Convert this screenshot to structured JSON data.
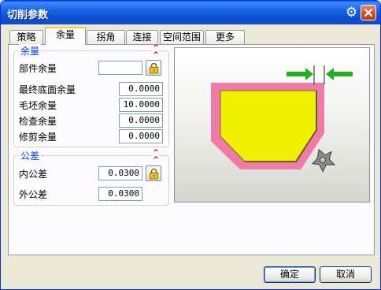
{
  "window": {
    "title": "切削参数"
  },
  "tabs": [
    {
      "label": "策略"
    },
    {
      "label": "余量"
    },
    {
      "label": "拐角"
    },
    {
      "label": "连接"
    },
    {
      "label": "空间范围"
    },
    {
      "label": "更多"
    }
  ],
  "active_tab": "余量",
  "stock_group": {
    "title": "余量",
    "part_stock": {
      "label": "部件余量",
      "value": ""
    },
    "final_floor_stock": {
      "label": "最终底面余量",
      "value": "0.0000"
    },
    "blank_stock": {
      "label": "毛坯余量",
      "value": "10.0000"
    },
    "check_stock": {
      "label": "检查余量",
      "value": "0.0000"
    },
    "trim_stock": {
      "label": "修剪余量",
      "value": "0.0000"
    }
  },
  "tolerance_group": {
    "title": "公差",
    "intol": {
      "label": "内公差",
      "value": "0.0300"
    },
    "outtol": {
      "label": "外公差",
      "value": "0.0300"
    }
  },
  "buttons": {
    "ok": "确定",
    "cancel": "取消"
  },
  "colors": {
    "title_bar": "#0a4dd0",
    "group_title": "#0046d5",
    "part_fill": "#f0f000",
    "stock_band": "#f07aa8",
    "arrow_green": "#20b020"
  },
  "icons": {
    "settings": "gear-icon",
    "close": "close-icon",
    "collapse": "double-chevron-up-icon",
    "lock": "lock-icon",
    "cutter": "cutter-icon"
  }
}
